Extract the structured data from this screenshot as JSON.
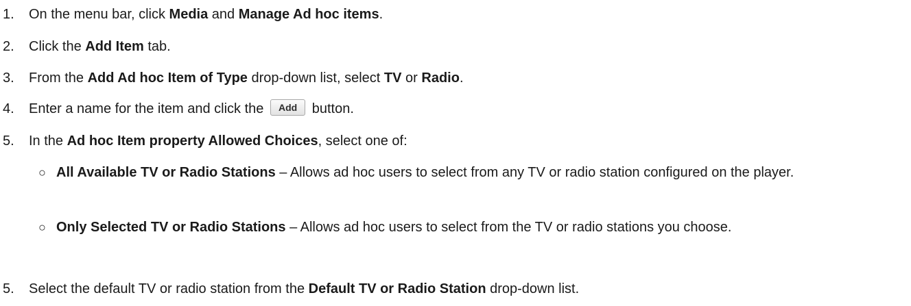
{
  "steps": [
    {
      "num": "1.",
      "parts": [
        "On the menu bar, click ",
        "Media",
        " and ",
        "Manage Ad hoc items",
        "."
      ]
    },
    {
      "num": "2.",
      "parts": [
        "Click the ",
        "Add Item",
        " tab."
      ]
    },
    {
      "num": "3.",
      "parts": [
        "From the ",
        "Add Ad hoc Item of Type",
        " drop-down list, select ",
        "TV",
        " or ",
        "Radio",
        "."
      ]
    },
    {
      "num": "4.",
      "before": "Enter a name for the item and click the",
      "button_label": "Add",
      "after": "button."
    },
    {
      "num": "5.",
      "parts": [
        "In the ",
        "Ad hoc Item property Allowed Choices",
        ", select one of:"
      ]
    },
    {
      "num": "5.",
      "parts": [
        "Select the default TV or radio station from the ",
        "Default TV or Radio Station",
        " drop-down list."
      ]
    }
  ],
  "sub_items": [
    {
      "bullet": "○",
      "bold": "All Available TV or Radio Stations",
      "text": " – Allows ad hoc users to select from any TV or radio station configured on the player."
    },
    {
      "bullet": "○",
      "bold": "Only Selected TV or Radio Stations",
      "text": " – Allows ad hoc users to select from the TV or radio stations you choose."
    }
  ]
}
